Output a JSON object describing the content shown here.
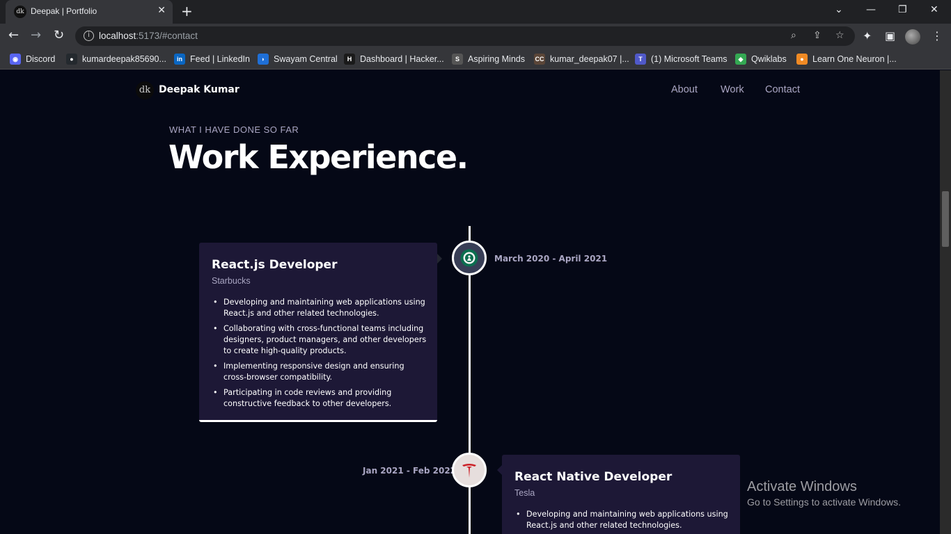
{
  "browser": {
    "tab_title": "Deepak | Portfolio",
    "tab_favicon": "dk",
    "url_host": "localhost",
    "url_rest": ":5173/#contact",
    "bookmarks": [
      {
        "label": "Discord",
        "icon": "discord-icon",
        "color": "#5865f2"
      },
      {
        "label": "kumardeepak85690...",
        "icon": "github-icon",
        "color": "#24292e"
      },
      {
        "label": "Feed | LinkedIn",
        "icon": "linkedin-icon",
        "color": "#0a66c2"
      },
      {
        "label": "Swayam Central",
        "icon": "swayam-icon",
        "color": "#1f6fd6"
      },
      {
        "label": "Dashboard | Hacker...",
        "icon": "hackerrank-icon",
        "color": "#1a1a1a"
      },
      {
        "label": "Aspiring Minds",
        "icon": "aspiring-minds-icon",
        "color": "#555555"
      },
      {
        "label": "kumar_deepak07 |...",
        "icon": "codechef-icon",
        "color": "#5b4638"
      },
      {
        "label": "(1) Microsoft Teams",
        "icon": "teams-icon",
        "color": "#5059c9"
      },
      {
        "label": "Qwiklabs",
        "icon": "qwiklabs-icon",
        "color": "#34a853"
      },
      {
        "label": "Learn One Neuron |...",
        "icon": "oneneuron-icon",
        "color": "#f08a24"
      }
    ]
  },
  "site": {
    "logo_mark": "dk",
    "brand_name": "Deepak Kumar",
    "nav": [
      "About",
      "Work",
      "Contact"
    ]
  },
  "section": {
    "subtitle": "WHAT I HAVE DONE SO FAR",
    "heading": "Work Experience."
  },
  "experiences": [
    {
      "title": "React.js Developer",
      "company": "Starbucks",
      "date": "March 2020 - April 2021",
      "icon": "starbucks-icon",
      "icon_bg": "#383e56",
      "points": [
        "Developing and maintaining web applications using React.js and other related technologies.",
        "Collaborating with cross-functional teams including designers, product managers, and other developers to create high-quality products.",
        "Implementing responsive design and ensuring cross-browser compatibility.",
        "Participating in code reviews and providing constructive feedback to other developers."
      ]
    },
    {
      "title": "React Native Developer",
      "company": "Tesla",
      "date": "Jan 2021 - Feb 2022",
      "icon": "tesla-icon",
      "icon_bg": "#e6dedd",
      "points": [
        "Developing and maintaining web applications using React.js and other related technologies."
      ]
    }
  ],
  "watermark": {
    "line1": "Activate Windows",
    "line2": "Go to Settings to activate Windows."
  },
  "colors": {
    "page_bg": "#050816",
    "card_bg": "#1d1836",
    "secondary_text": "#aaa6c3"
  }
}
